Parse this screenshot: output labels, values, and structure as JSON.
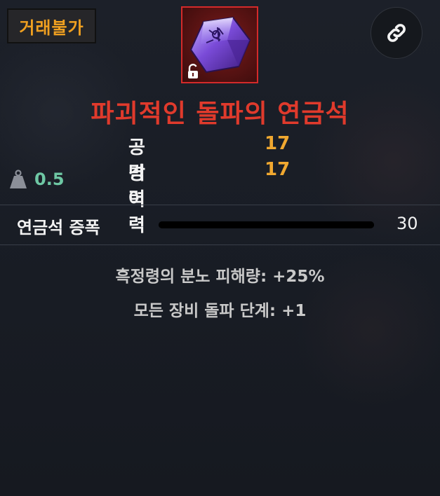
{
  "badge": {
    "label": "거래불가"
  },
  "item": {
    "name": "파괴적인 돌파의 연금석",
    "name_color": "#e03a2c",
    "icon": "purple-alchemy-stone-icon",
    "locked": true
  },
  "stats": [
    {
      "label": "공격력",
      "value": "17"
    },
    {
      "label": "방어력",
      "value": "17"
    }
  ],
  "weight": {
    "icon": "weight-icon",
    "value": "0.5"
  },
  "amplification": {
    "label": "연금석 증폭",
    "value": "30",
    "fill_fraction": 1.0
  },
  "effects": [
    "흑정령의 분노 피해량: +25%",
    "모든 장비 돌파 단계: +1"
  ],
  "link_button": {
    "icon": "link-icon"
  }
}
